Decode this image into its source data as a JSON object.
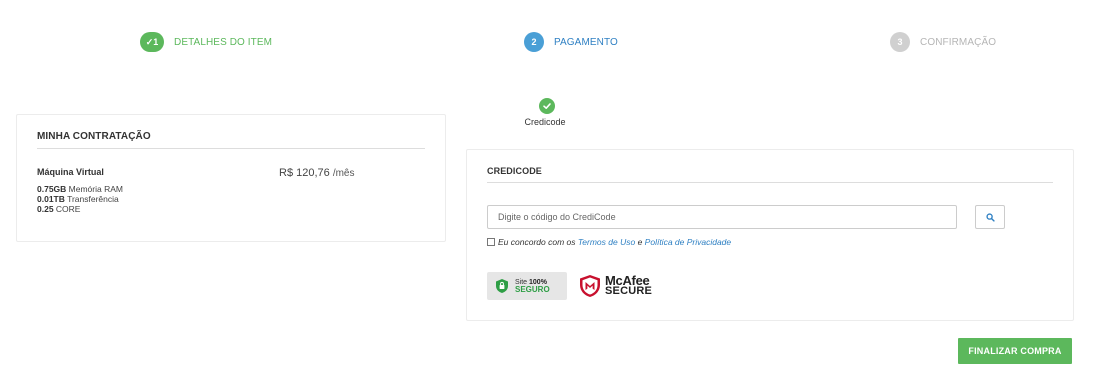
{
  "stepper": {
    "steps": [
      {
        "badge": "✓1",
        "label": "DETALHES DO ITEM"
      },
      {
        "badge": "2",
        "label": "PAGAMENTO"
      },
      {
        "badge": "3",
        "label": "CONFIRMAÇÃO"
      }
    ]
  },
  "payment_method": {
    "label": "Credicode",
    "icon": "check-circle-icon"
  },
  "summary": {
    "title": "MINHA CONTRATAÇÃO",
    "product_name": "Máquina Virtual",
    "price": "R$ 120,76",
    "period": "/mês",
    "specs": [
      {
        "value": "0.75GB",
        "label": "Memória RAM"
      },
      {
        "value": "0.01TB",
        "label": "Transferência"
      },
      {
        "value": "0.25",
        "label": "CORE"
      }
    ]
  },
  "credicode": {
    "title": "CREDICODE",
    "input_placeholder": "Digite o código do CrediCode",
    "input_value": "",
    "search_icon": "search-icon",
    "terms_prefix": "Eu concordo com os",
    "terms_link": "Termos de Uso",
    "terms_and": "e",
    "privacy_link": "Política de Privacidade",
    "terms_checked": false
  },
  "badges": {
    "site_line1_a": "Site",
    "site_line1_b": "100%",
    "site_line2": "SEGURO",
    "mcafee_line1": "McAfee",
    "mcafee_line2": "SECURE"
  },
  "actions": {
    "finalize_label": "FINALIZAR COMPRA"
  },
  "colors": {
    "accent_green": "#5cb85c",
    "accent_blue": "#2f80c3",
    "inactive_gray": "#d0d0d0"
  }
}
